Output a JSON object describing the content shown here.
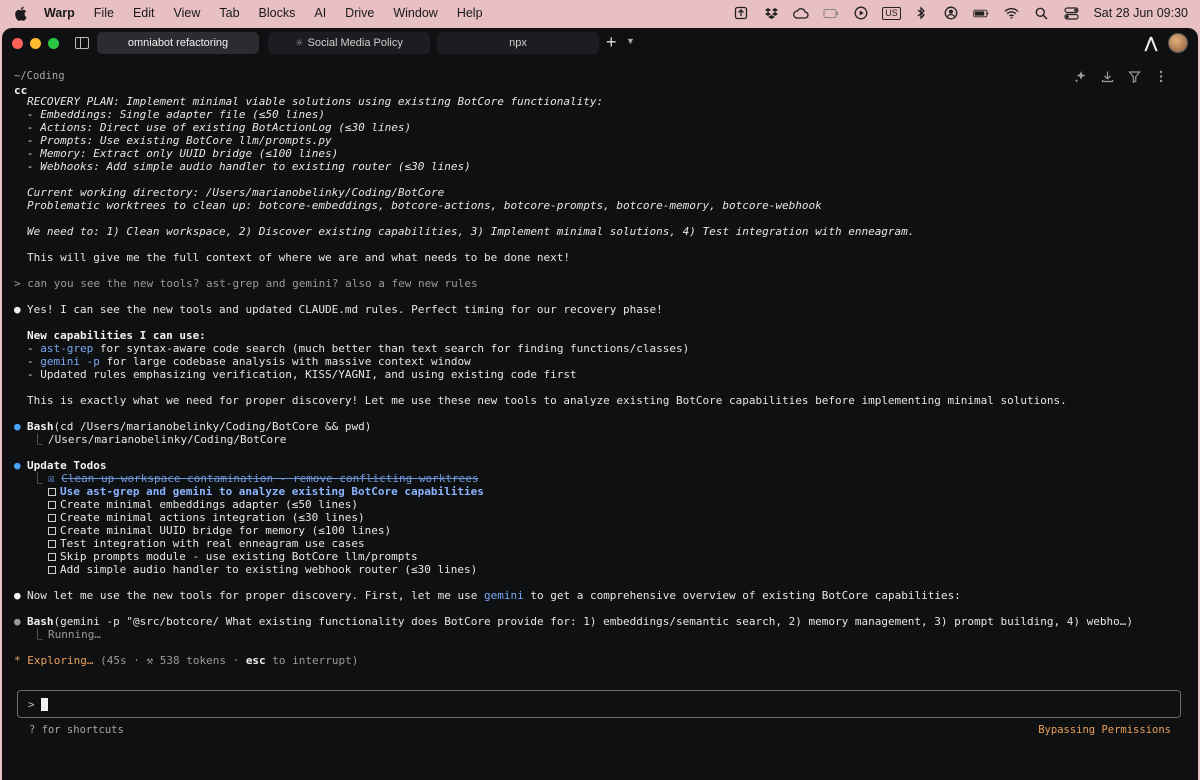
{
  "menubar": {
    "app": "Warp",
    "items": [
      "File",
      "Edit",
      "View",
      "Tab",
      "Blocks",
      "AI",
      "Drive",
      "Window",
      "Help"
    ],
    "input_source": "US",
    "clock": "Sat 28 Jun  09:30"
  },
  "tabs": [
    {
      "label": "omniabot refactoring"
    },
    {
      "label": "Social Media Policy"
    },
    {
      "label": "npx"
    }
  ],
  "block": {
    "cwd": "~/Coding",
    "command": "cc"
  },
  "lines": {
    "l0": "RECOVERY PLAN: Implement minimal viable solutions using existing BotCore functionality:",
    "l1": "- Embeddings: Single adapter file (≤50 lines)",
    "l2": "- Actions: Direct use of existing BotActionLog (≤30 lines)",
    "l3": "- Prompts: Use existing BotCore llm/prompts.py",
    "l4": "- Memory: Extract only UUID bridge (≤100 lines)",
    "l5": "- Webhooks: Add simple audio handler to existing router (≤30 lines)",
    "l6": "Current working directory: /Users/marianobelinky/Coding/BotCore",
    "l7": "Problematic worktrees to clean up: botcore-embeddings, botcore-actions, botcore-prompts, botcore-memory, botcore-webhook",
    "l8": "We need to: 1) Clean workspace, 2) Discover existing capabilities, 3) Implement minimal solutions, 4) Test integration with enneagram.",
    "l9": "This will give me the full context of where we are and what needs to be done next!",
    "user_prompt": "> can you see the new tools? ast-grep and gemini? also a few new rules",
    "r1": "Yes! I can see the new tools and updated CLAUDE.md rules. Perfect timing for our recovery phase!",
    "r2": "New capabilities I can use:",
    "r3_a": "- ",
    "r3_b": "ast-grep",
    "r3_c": " for syntax-aware code search (much better than text search for finding functions/classes)",
    "r4_a": "- ",
    "r4_b": "gemini -p",
    "r4_c": " for large codebase analysis with massive context window",
    "r5": "- Updated rules emphasizing verification, KISS/YAGNI, and using existing code first",
    "r6": "This is exactly what we need for proper discovery! Let me use these new tools to analyze existing BotCore capabilities before implementing minimal solutions.",
    "bash1_name": "Bash",
    "bash1_args": "(cd /Users/marianobelinky/Coding/BotCore && pwd)",
    "bash1_out": "/Users/marianobelinky/Coding/BotCore",
    "todos_title": "Update Todos",
    "todo0": "Clean up workspace contamination - remove conflicting worktrees",
    "todo1": "Use ast-grep and gemini to analyze existing BotCore capabilities",
    "todo2": "Create minimal embeddings adapter (≤50 lines)",
    "todo3": "Create minimal actions integration (≤30 lines)",
    "todo4": "Create minimal UUID bridge for memory (≤100 lines)",
    "todo5": "Test integration with real enneagram use cases",
    "todo6": "Skip prompts module - use existing BotCore llm/prompts",
    "todo7": "Add simple audio handler to existing webhook router (≤30 lines)",
    "r7_a": "Now let me use the new tools for proper discovery. First, let me use ",
    "r7_b": "gemini",
    "r7_c": " to get a comprehensive overview of existing BotCore capabilities:",
    "bash2_name": "Bash",
    "bash2_args": "(gemini -p \"@src/botcore/ What existing functionality does BotCore provide for: 1) embeddings/semantic search, 2) memory management, 3) prompt building, 4) webho…)",
    "bash2_out": "Running…",
    "status_a": "Exploring… ",
    "status_b": "(45s · ⚒ 538 tokens · ",
    "status_c": "esc",
    "status_d": " to interrupt)"
  },
  "input": {
    "prompt": ">",
    "hint": "? for shortcuts",
    "mode": "Bypassing Permissions"
  },
  "colors": {
    "accent_blue": "#4aa3ff",
    "status_orange": "#e8a25a",
    "background": "#0f1012"
  }
}
